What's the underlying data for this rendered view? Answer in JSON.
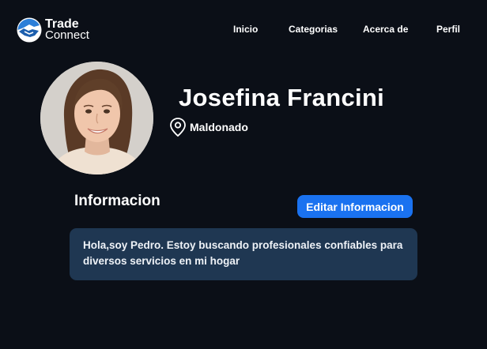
{
  "brand": {
    "line1": "Trade",
    "line2": "Connect",
    "icon": "handshake-logo-icon",
    "colors": {
      "accent": "#1a72f0"
    }
  },
  "nav": {
    "items": [
      {
        "label": "Inicio"
      },
      {
        "label": "Categorias"
      },
      {
        "label": "Acerca de"
      },
      {
        "label": "Perfil"
      }
    ]
  },
  "profile": {
    "name": "Josefina Francini",
    "location": "Maldonado",
    "location_icon": "map-pin-icon",
    "avatar": "profile-photo"
  },
  "info": {
    "title": "Informacion",
    "edit_label": "Editar Informacion",
    "bio": "Hola,soy Pedro. Estoy buscando profesionales confiables para diversos servicios en mi hogar"
  },
  "colors": {
    "background": "#0b0f17",
    "button": "#1a72f0",
    "bio_box": "#1f3752"
  }
}
